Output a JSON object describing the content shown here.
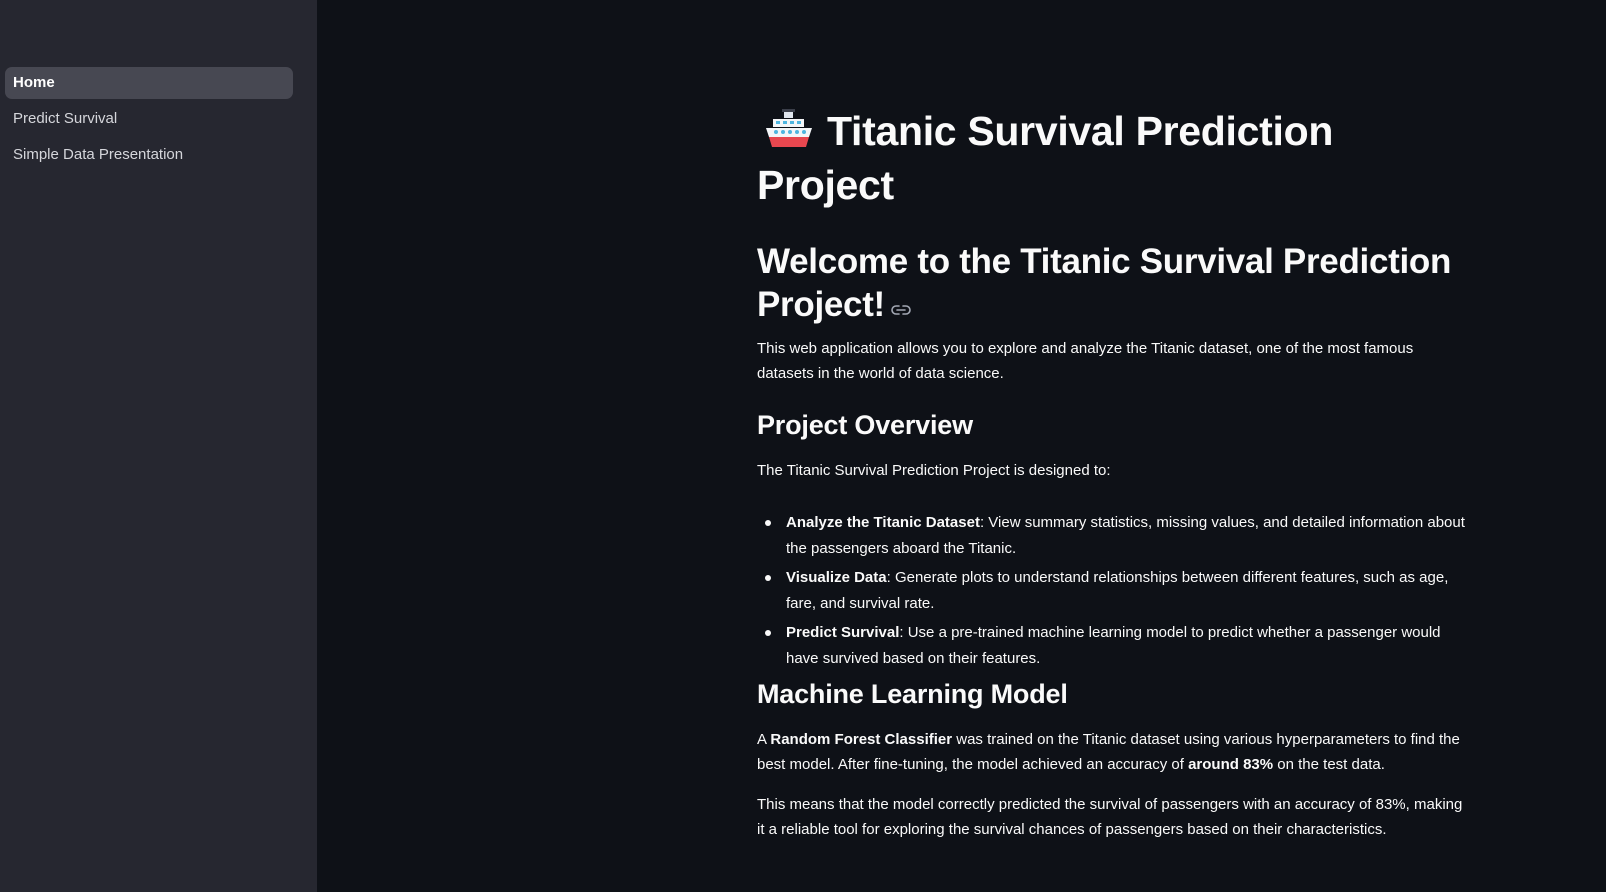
{
  "sidebar": {
    "items": [
      {
        "label": "Home"
      },
      {
        "label": "Predict Survival"
      },
      {
        "label": "Simple Data Presentation"
      }
    ]
  },
  "main": {
    "title_icon": "ship-icon",
    "title": "Titanic Survival Prediction Project",
    "welcome_heading": "Welcome to the Titanic Survival Prediction Project!",
    "intro": "This web application allows you to explore and analyze the Titanic dataset, one of the most famous datasets in the world of data science.",
    "overview_heading": "Project Overview",
    "overview_intro": "The Titanic Survival Prediction Project is designed to:",
    "features": [
      {
        "bold": "Analyze the Titanic Dataset",
        "text": ": View summary statistics, missing values, and detailed information about the passengers aboard the Titanic."
      },
      {
        "bold": "Visualize Data",
        "text": ": Generate plots to understand relationships between different features, such as age, fare, and survival rate."
      },
      {
        "bold": "Predict Survival",
        "text": ": Use a pre-trained machine learning model to predict whether a passenger would have survived based on their features."
      }
    ],
    "ml_heading": "Machine Learning Model",
    "ml_para1": {
      "pre": "A ",
      "bold1": "Random Forest Classifier",
      "mid": " was trained on the Titanic dataset using various hyperparameters to find the best model. After fine-tuning, the model achieved an accuracy of ",
      "bold2": "around 83%",
      "post": " on the test data."
    },
    "ml_para2": "This means that the model correctly predicted the survival of passengers with an accuracy of 83%, making it a reliable tool for exploring the survival chances of passengers based on their characteristics."
  },
  "colors": {
    "background": "#0e1117",
    "sidebar": "#262730",
    "active_item": "#474852",
    "text": "#fafafa"
  }
}
